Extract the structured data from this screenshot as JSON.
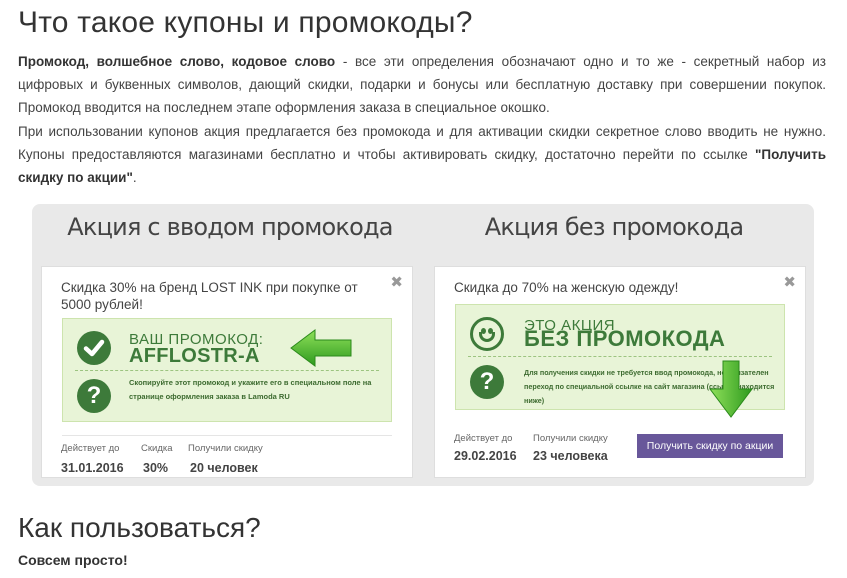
{
  "heading_1": "Что такое купоны и промокоды?",
  "para1": {
    "bold": "Промокод, волшебное слово, кодовое слово",
    "text": " - все эти определения обозначают одно и то же - секретный набор из цифровых и буквенных символов, дающий скидки, подарки и бонусы или бесплатную доставку при совершении покупок. Промокод вводится на последнем этапе оформления заказа в специальное окошко."
  },
  "para2": {
    "text": "При использовании купонов акция предлагается без промокода и для активации скидки секретное слово вводить не нужно. Купоны предоставляются магазинами бесплатно и чтобы активировать скидку, достаточно перейти по ссылке ",
    "bold": "\"Получить скидку по акции\"",
    "tail": "."
  },
  "panel": {
    "left_title": "Акция с вводом промокода",
    "right_title": "Акция без промокода"
  },
  "coupon_left": {
    "close": "✖",
    "description": "Скидка 30% на бренд LOST INK при покупке от 5000 рублей!",
    "code_label": "ВАШ ПРОМОКОД:",
    "code_value": "AFFLOSTR-A",
    "note": "Скопируйте этот промокод и укажите его в специальном поле на странице оформления заказа в Lamoda RU",
    "meta": [
      {
        "label": "Действует до",
        "value": "31.01.2016"
      },
      {
        "label": "Скидка",
        "value": "30%"
      },
      {
        "label": "Получили скидку",
        "value": "20 человек"
      }
    ],
    "check_glyph": "✔",
    "question_glyph": "?"
  },
  "coupon_right": {
    "close": "✖",
    "description": "Скидка до 70% на женскую одежду!",
    "promo_label": "ЭТО АКЦИЯ",
    "promo_value": "БЕЗ ПРОМОКОДА",
    "note": "Для получения скидки не требуется ввод промокода, но обязателен переход по специальной ссылке на сайт магазина (ссылка находится ниже)",
    "meta": [
      {
        "label": "Действует до",
        "value": "29.02.2016"
      },
      {
        "label": "Получили скидку",
        "value": "23 человека"
      }
    ],
    "cta_label": "Получить скидку по акции",
    "question_glyph": "?"
  },
  "heading_2": "Как пользоваться?",
  "strong_line": "Совсем просто!",
  "colors": {
    "accent_green": "#3d7a3a",
    "green_bg": "#e8f4d7",
    "button": "#68579a",
    "panel_bg": "#e9e9e9"
  }
}
